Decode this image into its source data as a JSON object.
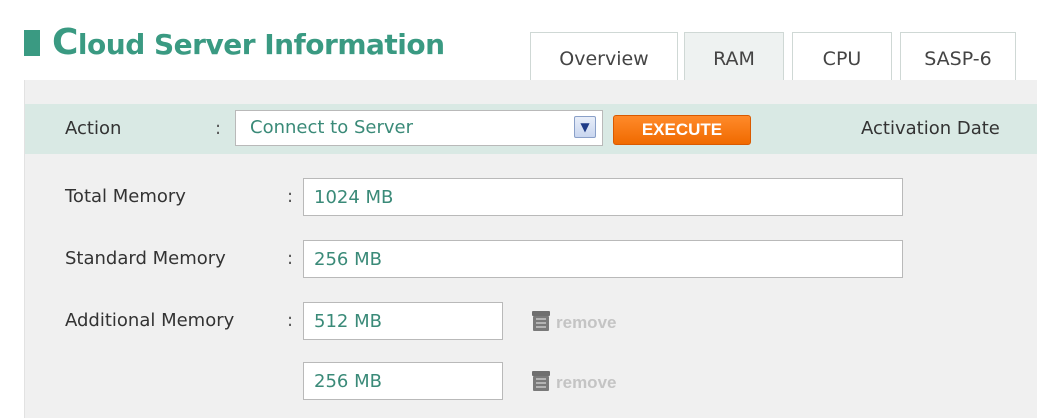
{
  "header": {
    "title_first_letter": "C",
    "title_rest": "loud Server Information"
  },
  "tabs": [
    {
      "label": "Overview",
      "active": false
    },
    {
      "label": "RAM",
      "active": true
    },
    {
      "label": "CPU",
      "active": false
    },
    {
      "label": "SASP-6",
      "active": false
    }
  ],
  "action_bar": {
    "action_label": "Action",
    "colon": ":",
    "selected_action": "Connect to Server",
    "execute_label": "EXECUTE",
    "activation_label": "Activation Date"
  },
  "memory": {
    "total_label": "Total Memory",
    "total_value": "1024 MB",
    "standard_label": "Standard Memory",
    "standard_value": "256 MB",
    "additional_label": "Additional Memory",
    "additional": [
      {
        "value": "512 MB",
        "remove_label": "remove"
      },
      {
        "value": "256 MB",
        "remove_label": "remove"
      }
    ]
  },
  "colors": {
    "accent": "#3a9a82",
    "execute": "#f47a13",
    "action_bar_bg": "#d9e9e4",
    "panel_bg": "#f0f0f0",
    "field_text": "#3a8a78"
  },
  "icons": {
    "dropdown": "chevron-down-icon",
    "remove": "trash-icon"
  }
}
